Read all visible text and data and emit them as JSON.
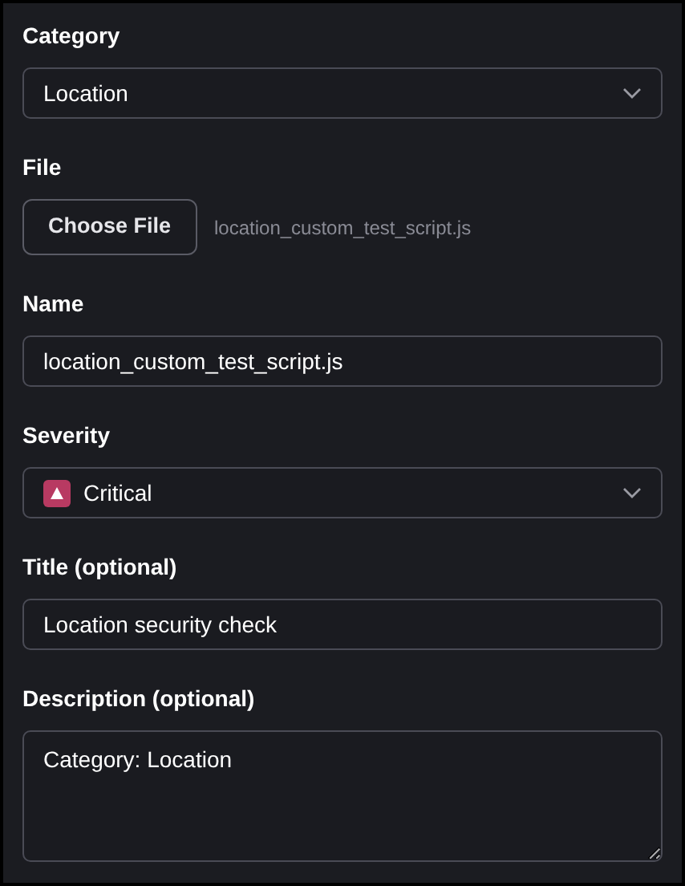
{
  "fields": [
    {
      "kind": "select",
      "label": "Category",
      "value": "Location"
    },
    {
      "kind": "file",
      "label": "File",
      "button": "Choose File",
      "filename": "location_custom_test_script.js"
    },
    {
      "kind": "text",
      "label": "Name",
      "value": "location_custom_test_script.js"
    },
    {
      "kind": "select",
      "label": "Severity",
      "value": "Critical",
      "color": "#b83a62"
    },
    {
      "kind": "text",
      "label": "Title (optional)",
      "value": "Location security check"
    },
    {
      "kind": "textarea",
      "label": "Description (optional)",
      "value": "Category: Location"
    }
  ]
}
